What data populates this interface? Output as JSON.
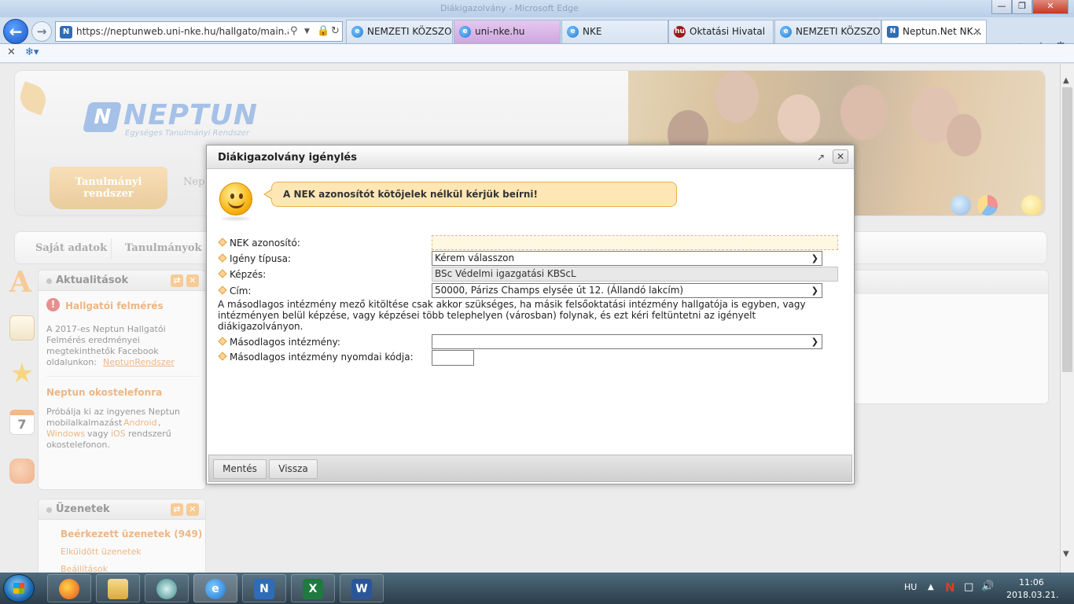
{
  "browser": {
    "window_title": "Diákigazolvány - Microsoft Edge",
    "address": {
      "url": "https://neptunweb.uni-nke.hu/hallgato/main.aspx?",
      "search_icon": "search-icon",
      "lock_icon": "lock-icon",
      "refresh_icon": "refresh-icon"
    },
    "tabs": [
      {
        "label": "NEMZETI KÖZSZO...",
        "icon": "ie-icon"
      },
      {
        "label": "uni-nke.hu",
        "icon": "ie-icon"
      },
      {
        "label": "NKE",
        "icon": "ie-icon"
      },
      {
        "label": "Oktatási Hivatal",
        "icon": "hu-icon"
      },
      {
        "label": "NEMZETI KÖZSZO...",
        "icon": "ie-icon"
      },
      {
        "label": "Neptun.Net NK...",
        "icon": "neptun-icon"
      }
    ],
    "close_tab": "✕"
  },
  "neptun": {
    "logo_word": "NEPTUN",
    "logo_sub": "Egységes Tanulmányi Rendszer",
    "main_tab": "Tanulmányi rendszer",
    "second_tab": "Nep",
    "menu": [
      "Saját adatok",
      "Tanulmányok"
    ]
  },
  "sidebar": {
    "news": {
      "title": "Aktualitások",
      "item1_title": "Hallgatói felmérés",
      "item1_text_a": "A 2017-es Neptun Hallgatói",
      "item1_text_b": "Felmérés eredményei",
      "item1_text_c": "megtekinthetők Facebook",
      "item1_text_d": "oldalunkon:",
      "item1_link": "NeptunRendszer",
      "item2_title": "Neptun okostelefonra",
      "item2_text_a": "Próbálja ki az ingyenes Neptun",
      "item2_text_b": "mobilalkalmazást",
      "item2_link_android": "Android",
      "item2_text_c": ",",
      "item2_link_windows": "Windows",
      "item2_text_d": "vagy",
      "item2_link_ios": "iOS",
      "item2_text_e": "rendszerű",
      "item2_text_f": "okostelefonon."
    },
    "messages": {
      "title": "Üzenetek",
      "inbox": "Beérkezett üzenetek (949)",
      "sent": "Elküldött üzenetek",
      "settings": "Beállítások"
    },
    "calendar_day": "7"
  },
  "dialog": {
    "title": "Diákigazolvány igénylés",
    "bubble": "A NEK azonosítót kötőjelek nélkül kérjük beírni!",
    "fields": {
      "nek_label": "NEK azonosító:",
      "nek_value": "",
      "type_label": "Igény típusa:",
      "type_value": "Kérem válasszon",
      "training_label": "Képzés:",
      "training_value": "BSc Védelmi igazgatási KBScL",
      "address_label": "Cím:",
      "address_value": "50000, Párizs Champs elysée út 12. (Állandó lakcím)",
      "secondary_label": "Másodlagos intézmény:",
      "secondary_value": "",
      "print_code_label": "Másodlagos intézmény nyomdai kódja:",
      "print_code_value": ""
    },
    "note": "A másodlagos intézmény mező kitöltése csak akkor szükséges, ha másik felsőoktatási intézmény hallgatója is egyben, vagy intézményen belül képzése, vagy képzései több telephelyen (városban) folynak, és ezt kéri feltüntetni az igényelt diákigazolványon.",
    "buttons": {
      "save": "Mentés",
      "back": "Vissza"
    }
  },
  "taskbar": {
    "lang": "HU",
    "time": "11:06",
    "date": "2018.03.21."
  }
}
